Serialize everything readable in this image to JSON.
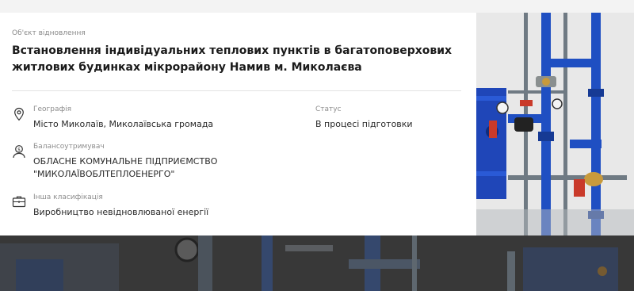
{
  "object_type_label": "Об'єкт відновлення",
  "title": "Встановлення індивідуальних теплових пунктів в багатоповерхових житлових будинках мікрорайону Намив м. Миколаєва",
  "fields": {
    "geography": {
      "label": "Географія",
      "value": "Місто Миколаїв, Миколаївська громада",
      "icon": "location-pin-icon"
    },
    "status": {
      "label": "Статус",
      "value": "В процесі підготовки"
    },
    "balance_holder": {
      "label": "Балансоутримувач",
      "value": "ОБЛАСНЕ КОМУНАЛЬНЕ ПІДПРИЄМСТВО \"МИКОЛАЇВОБЛТЕПЛОЕНЕРГО\"",
      "icon": "person-money-icon"
    },
    "other_classification": {
      "label": "Інша класифікація",
      "value": "Виробництво невідновлюваної енергії",
      "icon": "briefcase-icon"
    }
  },
  "colors": {
    "pipe_blue": "#1f4fc2",
    "frame_grey": "#6f7a83",
    "valve_red": "#c93a2a",
    "brass": "#c89a3c"
  }
}
